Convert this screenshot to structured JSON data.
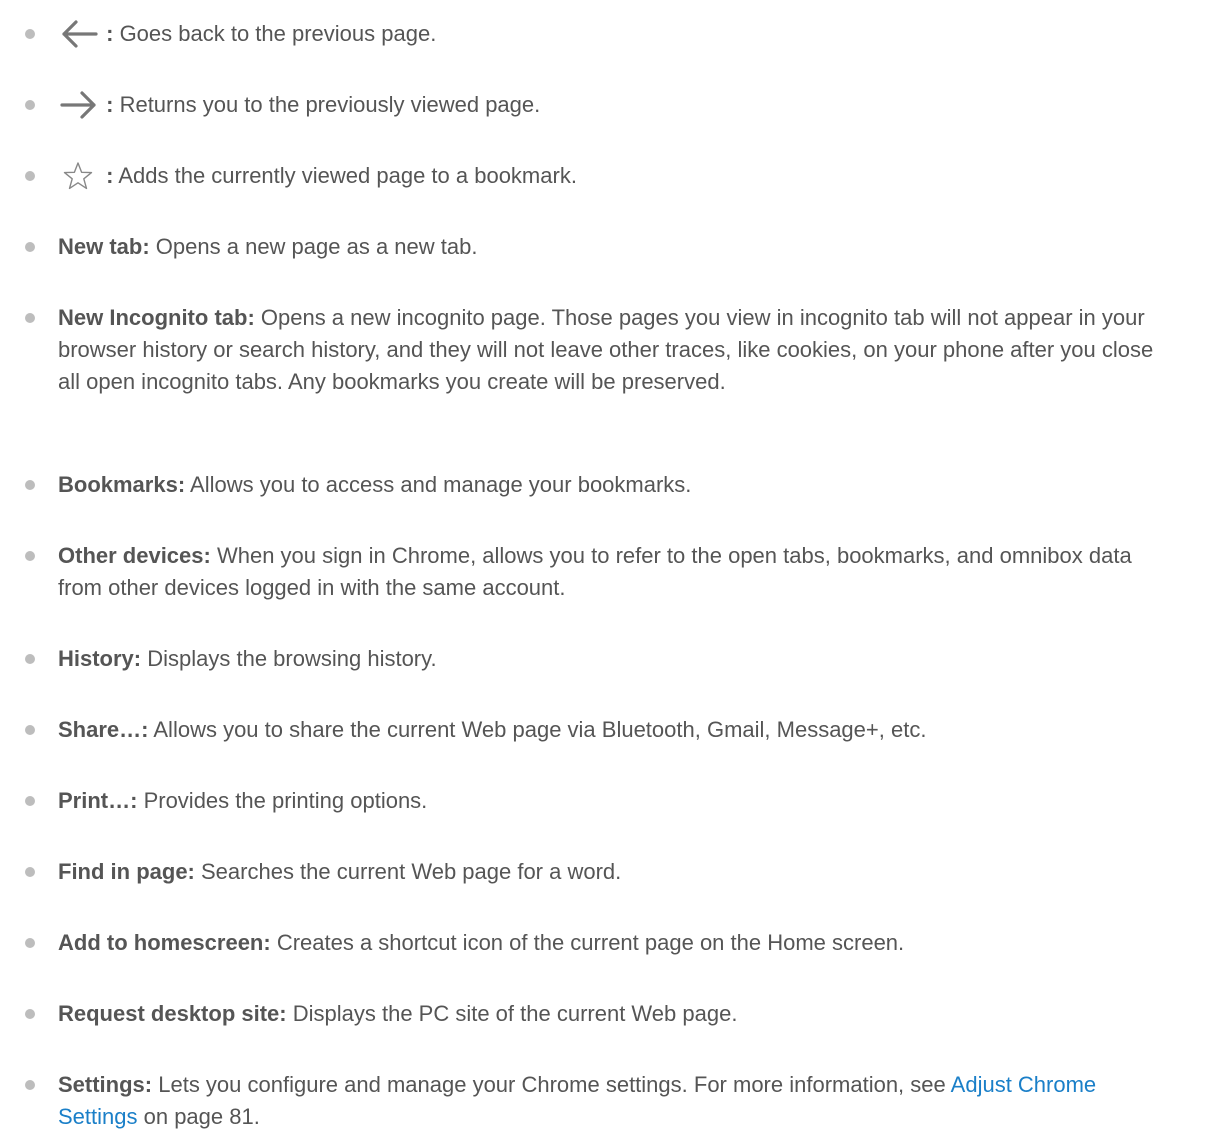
{
  "items": [
    {
      "icon": "back-arrow-icon",
      "term": ":",
      "desc": " Goes back to the previous page."
    },
    {
      "icon": "forward-arrow-icon",
      "term": ":",
      "desc": " Returns you to the previously viewed page."
    },
    {
      "icon": "star-outline-icon",
      "term": ":",
      "desc": " Adds the currently viewed page to a bookmark."
    },
    {
      "term": "New tab:",
      "desc": " Opens a new page as a new tab."
    },
    {
      "term": "New Incognito tab:",
      "desc": " Opens a new incognito page. Those pages you view in incognito tab will not appear in your browser history or search history, and they will not leave other traces, like cookies, on your phone after you close all open incognito tabs. Any bookmarks you create will be preserved."
    },
    {
      "term": "Bookmarks:",
      "desc": " Allows you to access and manage your bookmarks."
    },
    {
      "term": "Other devices:",
      "desc": " When you sign in Chrome, allows you to refer to the open tabs, bookmarks, and omnibox data from other devices logged in with the same account."
    },
    {
      "term": "History:",
      "desc": " Displays the browsing history."
    },
    {
      "term": "Share…:",
      "desc": " Allows you to share the current Web page via Bluetooth, Gmail, Message+, etc."
    },
    {
      "term": "Print…:",
      "desc": " Provides the printing options."
    },
    {
      "term": "Find in page:",
      "desc": " Searches the current Web page for a word."
    },
    {
      "term": "Add to homescreen:",
      "desc": " Creates a shortcut icon of the current page on the Home screen."
    },
    {
      "term": "Request desktop site:",
      "desc": " Displays the PC site of the current Web page."
    },
    {
      "term": "Settings:",
      "desc": " Lets you configure and manage your Chrome settings. For more information, see ",
      "link": "Adjust Chrome Settings",
      "after": " on page 81."
    }
  ],
  "colors": {
    "text": "#555555",
    "bullet": "#bdbdbd",
    "link": "#1a7fc8",
    "icon": "#777777"
  }
}
